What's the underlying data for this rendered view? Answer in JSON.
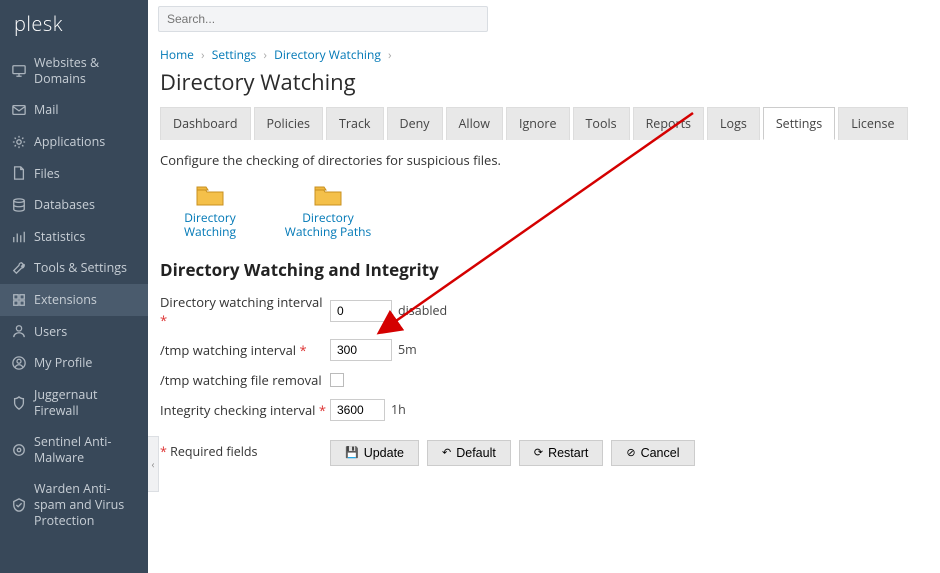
{
  "brand": "plesk",
  "search": {
    "placeholder": "Search..."
  },
  "sidebar": [
    {
      "label": "Websites & Domains",
      "icon": "monitor"
    },
    {
      "label": "Mail",
      "icon": "mail"
    },
    {
      "label": "Applications",
      "icon": "gear"
    },
    {
      "label": "Files",
      "icon": "file"
    },
    {
      "label": "Databases",
      "icon": "db"
    },
    {
      "label": "Statistics",
      "icon": "stats"
    },
    {
      "label": "Tools & Settings",
      "icon": "wrench"
    },
    {
      "label": "Extensions",
      "icon": "ext",
      "active": true
    },
    {
      "label": "Users",
      "icon": "user"
    },
    {
      "label": "My Profile",
      "icon": "profile"
    },
    {
      "label": "Juggernaut Firewall",
      "icon": "shield"
    },
    {
      "label": "Sentinel Anti-Malware",
      "icon": "sentinel"
    },
    {
      "label": "Warden Anti-spam and Virus Protection",
      "icon": "warden"
    }
  ],
  "breadcrumb": [
    {
      "label": "Home"
    },
    {
      "label": "Settings"
    },
    {
      "label": "Directory Watching"
    }
  ],
  "page_title": "Directory Watching",
  "tabs": [
    {
      "label": "Dashboard"
    },
    {
      "label": "Policies"
    },
    {
      "label": "Track"
    },
    {
      "label": "Deny"
    },
    {
      "label": "Allow"
    },
    {
      "label": "Ignore"
    },
    {
      "label": "Tools"
    },
    {
      "label": "Reports"
    },
    {
      "label": "Logs"
    },
    {
      "label": "Settings",
      "active": true
    },
    {
      "label": "License"
    }
  ],
  "desc": "Configure the checking of directories for suspicious files.",
  "tiles": [
    {
      "label": "Directory Watching"
    },
    {
      "label": "Directory Watching Paths"
    }
  ],
  "section_title": "Directory Watching and Integrity",
  "fields": {
    "dw_interval": {
      "label": "Directory watching interval",
      "value": "0",
      "suffix": "disabled",
      "required": true
    },
    "tmp_interval": {
      "label": "/tmp watching interval",
      "value": "300",
      "suffix": "5m",
      "required": true
    },
    "tmp_removal": {
      "label": "/tmp watching file removal",
      "required": false
    },
    "int_interval": {
      "label": "Integrity checking interval",
      "value": "3600",
      "suffix": "1h",
      "required": true
    }
  },
  "required_note": "Required fields",
  "buttons": {
    "update": "Update",
    "default": "Default",
    "restart": "Restart",
    "cancel": "Cancel"
  },
  "colors": {
    "link": "#0078b6",
    "required": "#d33",
    "arrow": "#d40000"
  }
}
